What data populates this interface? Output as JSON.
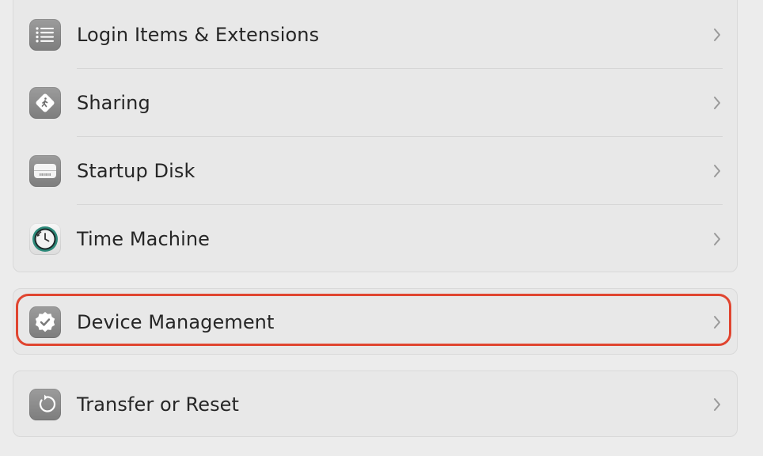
{
  "settings": {
    "items": [
      {
        "label": "Login Items & Extensions",
        "icon": "list-icon"
      },
      {
        "label": "Sharing",
        "icon": "sharing-icon"
      },
      {
        "label": "Startup Disk",
        "icon": "disk-icon"
      },
      {
        "label": "Time Machine",
        "icon": "time-machine-icon"
      },
      {
        "label": "Device Management",
        "icon": "badge-checkmark-icon"
      },
      {
        "label": "Transfer or Reset",
        "icon": "reset-icon"
      }
    ]
  },
  "colors": {
    "highlight": "#e04530",
    "icon_gray": "#8a8a8a",
    "background": "#ececec"
  }
}
